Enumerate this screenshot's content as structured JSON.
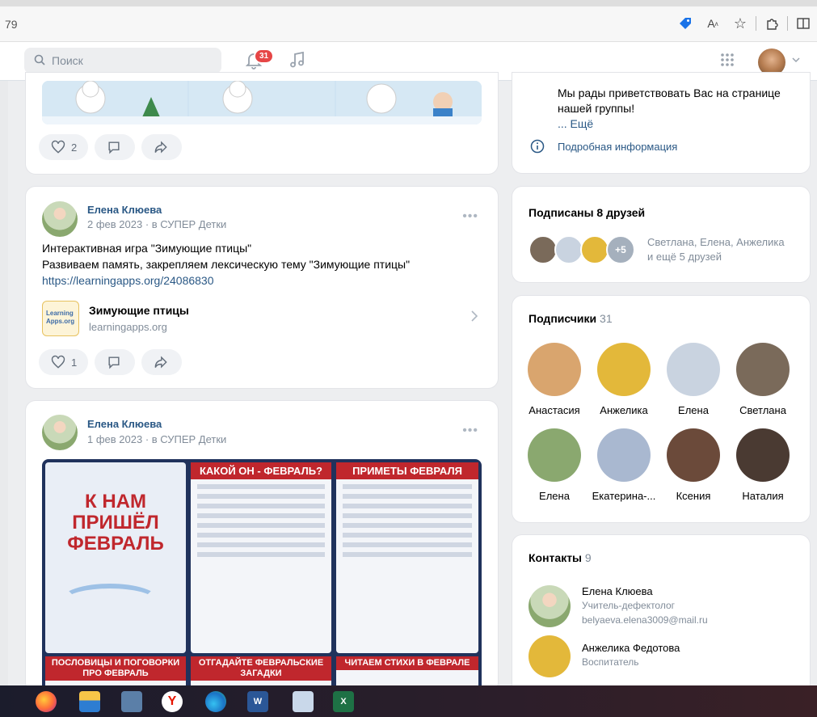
{
  "browser": {
    "url_fragment": "79",
    "icons": [
      "tag-icon",
      "read-aloud-icon",
      "favorite-star-icon",
      "extensions-icon",
      "split-screen-icon"
    ]
  },
  "header": {
    "search_placeholder": "Поиск",
    "notifications_count": "31",
    "icons": [
      "search-icon",
      "bell-icon",
      "music-icon",
      "apps-grid-icon",
      "chevron-down-icon"
    ]
  },
  "posts": [
    {
      "likes": "2"
    },
    {
      "author": "Елена Клюева",
      "meta": "2 фев 2023 · в СУПЕР Детки",
      "dots": "•••",
      "text_lines": [
        "Интерактивная игра \"Зимующие птицы\"",
        "Развиваем память, закрепляем лексическую тему \"Зимующие птицы\""
      ],
      "link": "https://learningapps.org/24086830",
      "attachment": {
        "thumb_text": "Learning Apps.org",
        "title": "Зимующие птицы",
        "domain": "learningapps.org"
      },
      "likes": "1"
    },
    {
      "author": "Елена Клюева",
      "meta": "1 фев 2023 · в СУПЕР Детки",
      "dots": "•••",
      "poster": {
        "main_title": "К НАМ ПРИШЁЛ ФЕВРАЛЬ",
        "panel2_title": "КАКОЙ ОН - ФЕВРАЛЬ?",
        "panel3_title": "ПРИМЕТЫ ФЕВРАЛЯ",
        "panel4_title": "ПОСЛОВИЦЫ И ПОГОВОРКИ ПРО ФЕВРАЛЬ",
        "panel5_title": "ОТГАДАЙТЕ ФЕВРАЛЬСКИЕ ЗАГАДКИ",
        "panel6_title": "ЧИТАЕМ СТИХИ В ФЕВРАЛЕ"
      }
    }
  ],
  "group_info": {
    "welcome_text_line1": "Мы рады приветствовать Вас на странице",
    "welcome_text_line2": "нашей группы!",
    "more": "... Ещё",
    "details": "Подробная информация"
  },
  "friends_block": {
    "title": "Подписаны 8 друзей",
    "extra": "+5",
    "names": "Светлана, Елена, Анжелика",
    "more": "и ещё 5 друзей"
  },
  "subscribers": {
    "title": "Подписчики",
    "count": "31",
    "people": [
      {
        "name": "Анастасия",
        "color": "#d9a56e"
      },
      {
        "name": "Анжелика",
        "color": "#e3b83a"
      },
      {
        "name": "Елена",
        "color": "#c9d3e0"
      },
      {
        "name": "Светлана",
        "color": "#7a6a5a"
      },
      {
        "name": "Елена",
        "color": "#8aa86f"
      },
      {
        "name": "Екатерина-...",
        "color": "#a9b8d0"
      },
      {
        "name": "Ксения",
        "color": "#6b4a3a"
      },
      {
        "name": "Наталия",
        "color": "#4a3a32"
      }
    ]
  },
  "contacts": {
    "title": "Контакты",
    "count": "9",
    "items": [
      {
        "name": "Елена Клюева",
        "role": "Учитель-дефектолог",
        "email": "belyaeva.elena3009@mail.ru"
      },
      {
        "name": "Анжелика Федотова",
        "role": "Воспитатель"
      }
    ]
  }
}
